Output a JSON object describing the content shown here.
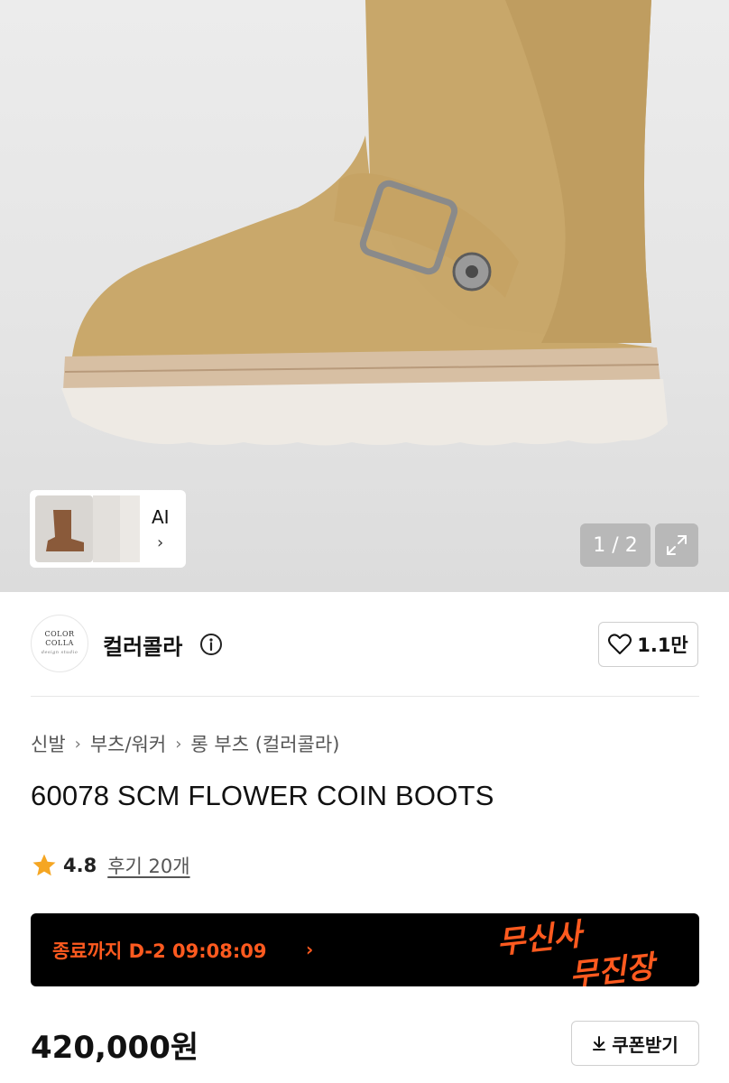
{
  "gallery": {
    "ai_label": "AI",
    "page_indicator": "1 / 2"
  },
  "brand": {
    "logo_line1": "COLOR",
    "logo_line2": "COLLA",
    "logo_script": "design studio",
    "name": "컬러콜라",
    "like_count": "1.1만"
  },
  "breadcrumb": {
    "items": [
      "신발",
      "부츠/워커",
      "롱 부츠 (컬러콜라)"
    ]
  },
  "product": {
    "title": "60078 SCM FLOWER COIN BOOTS",
    "rating": "4.8",
    "review_label": "후기 20개",
    "price": "420,000원"
  },
  "promo": {
    "countdown_text": "종료까지 D-2 09:08:09",
    "art_line1": "무신사",
    "art_line2": "무진장",
    "accent_color": "#ff5a1f"
  },
  "coupon": {
    "label": "쿠폰받기"
  },
  "icons": {
    "info": "info-icon",
    "heart": "heart-icon",
    "star": "star-icon",
    "expand": "expand-icon",
    "download": "download-icon"
  }
}
